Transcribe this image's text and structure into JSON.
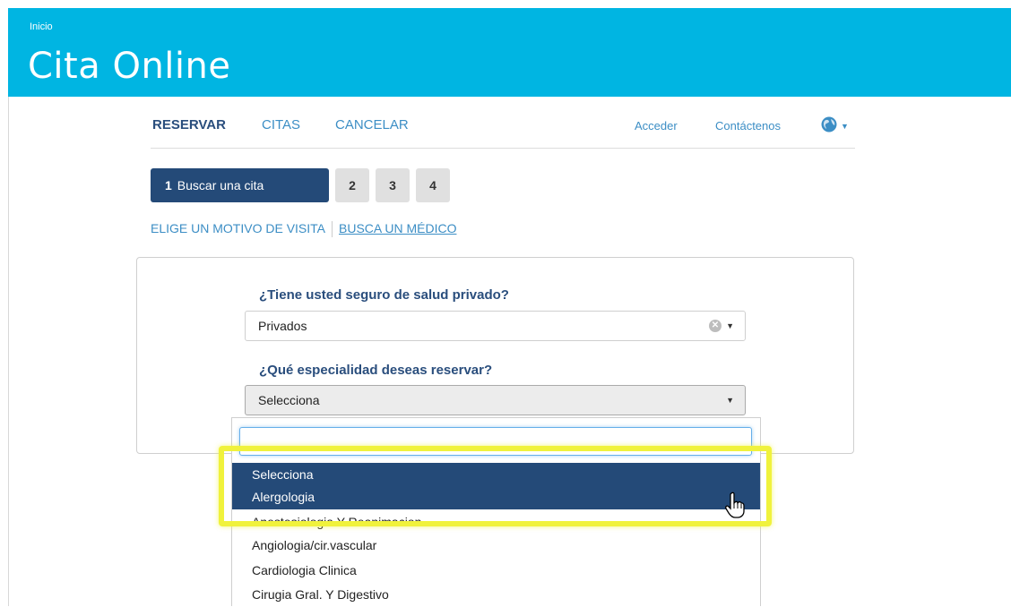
{
  "header": {
    "breadcrumb": "Inicio",
    "title": "Cita Online",
    "color": "#00b5e2"
  },
  "nav": {
    "reservar": "RESERVAR",
    "citas": "CITAS",
    "cancelar": "CANCELAR",
    "acceder": "Acceder",
    "contactenos": "Contáctenos",
    "language_icon": "globe-icon"
  },
  "steps": {
    "step1_number": "1",
    "step1_label": "Buscar una cita",
    "step2": "2",
    "step3": "3",
    "step4": "4"
  },
  "search_tabs": {
    "motivo": "ELIGE UN MOTIVO DE VISITA",
    "medico": "BUSCA UN MÉDICO"
  },
  "form": {
    "insurance_question": "¿Tiene usted seguro de salud privado?",
    "insurance_value": "Privados",
    "specialty_question": "¿Qué especialidad deseas reservar?",
    "specialty_value": "Selecciona"
  },
  "dropdown": {
    "search_value": "",
    "options": [
      "Selecciona",
      "Alergologia",
      "Anestesiologia Y Reanimacion",
      "Angiologia/cir.vascular",
      "Cardiologia Clinica",
      "Cirugia Gral. Y Digestivo"
    ],
    "highlighted": [
      "Selecciona",
      "Alergologia"
    ]
  },
  "colors": {
    "accent": "#244a78",
    "link": "#3c8ec5",
    "highlight_box": "#f0f23c"
  }
}
